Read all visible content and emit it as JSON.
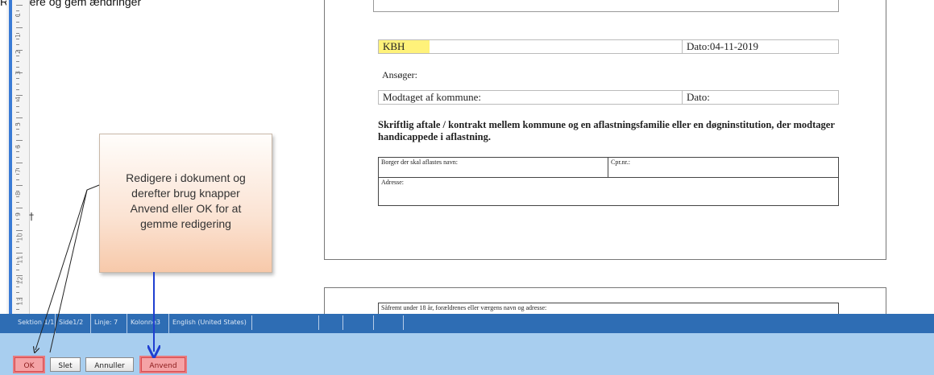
{
  "caption": "Redigere og gem ændringer",
  "ruler": {
    "numbers": [
      "1",
      "1",
      "2",
      "3",
      "4",
      "5",
      "6",
      "7",
      "8",
      "9",
      "10",
      "11",
      "12",
      "13",
      "14"
    ],
    "cursor": "†"
  },
  "document": {
    "kbh": "KBH",
    "dato_label": "Dato:04-11-2019",
    "ansoger": "Ansøger:",
    "modtaget": "Modtaget af kommune:",
    "dato2": "Dato:",
    "heading": "Skriftlig aftale / kontrakt mellem kommune og en aflastningsfamilie eller en døgninstitution, der modtager handicappede i aflastning.",
    "table": {
      "borger": "Borger der skal aflastes navn:",
      "cpr": "Cpr.nr.:",
      "adresse": "Adresse:"
    },
    "page2_line": "Såfremt under 18 år, forældrenes eller værgens navn og adresse:"
  },
  "callout": {
    "line1": "Redigere i dokument og",
    "line2": "derefter brug knapper",
    "line3": "Anvend eller OK for at",
    "line4": "gemme redigering"
  },
  "statusbar": {
    "sektion": "Sektion 1/1",
    "side": "Side1/2",
    "linje": "Linje: 7",
    "kolonne": "Kolonne3",
    "language": "English (United States)"
  },
  "buttons": {
    "ok": "OK",
    "slet": "Slet",
    "annuller": "Annuller",
    "anvend": "Anvend"
  },
  "colors": {
    "statusbar": "#2e6db4",
    "bottom": "#a8ceef",
    "highlight": "#fff27a",
    "callout": "#f7c9aa",
    "arrow_blue": "#1f3fd1"
  }
}
